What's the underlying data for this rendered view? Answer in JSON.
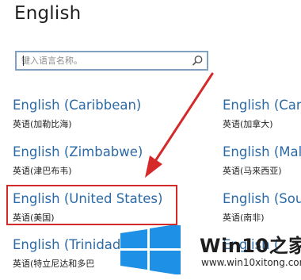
{
  "page_title": "English",
  "search": {
    "placeholder": "键入语言名称。",
    "value": ""
  },
  "languages": [
    {
      "name": "English (Caribbean)",
      "native": "英语(加勒比海)"
    },
    {
      "name": "English (Can",
      "native": "英语(加拿大)"
    },
    {
      "name": "English (Zimbabwe)",
      "native": "英语(津巴布韦)"
    },
    {
      "name": "English (Mal",
      "native": "英语(马来西亚)"
    },
    {
      "name": "English (United States)",
      "native": "英语(美国)"
    },
    {
      "name": "English (Sou",
      "native": "英语(南非)"
    },
    {
      "name": "English (Trinidad",
      "native": "英语(特立尼达和多巴"
    },
    {
      "name": "English (",
      "native": ""
    }
  ],
  "annotation": {
    "color": "#d42a2a"
  },
  "watermark": {
    "title_part1": "Win10",
    "title_part2": "之家",
    "url": "www.win10xitong.com",
    "logo_color": "#1e90e6"
  },
  "icons": [
    "search-icon",
    "windows-logo-icon",
    "annotation-arrow"
  ]
}
